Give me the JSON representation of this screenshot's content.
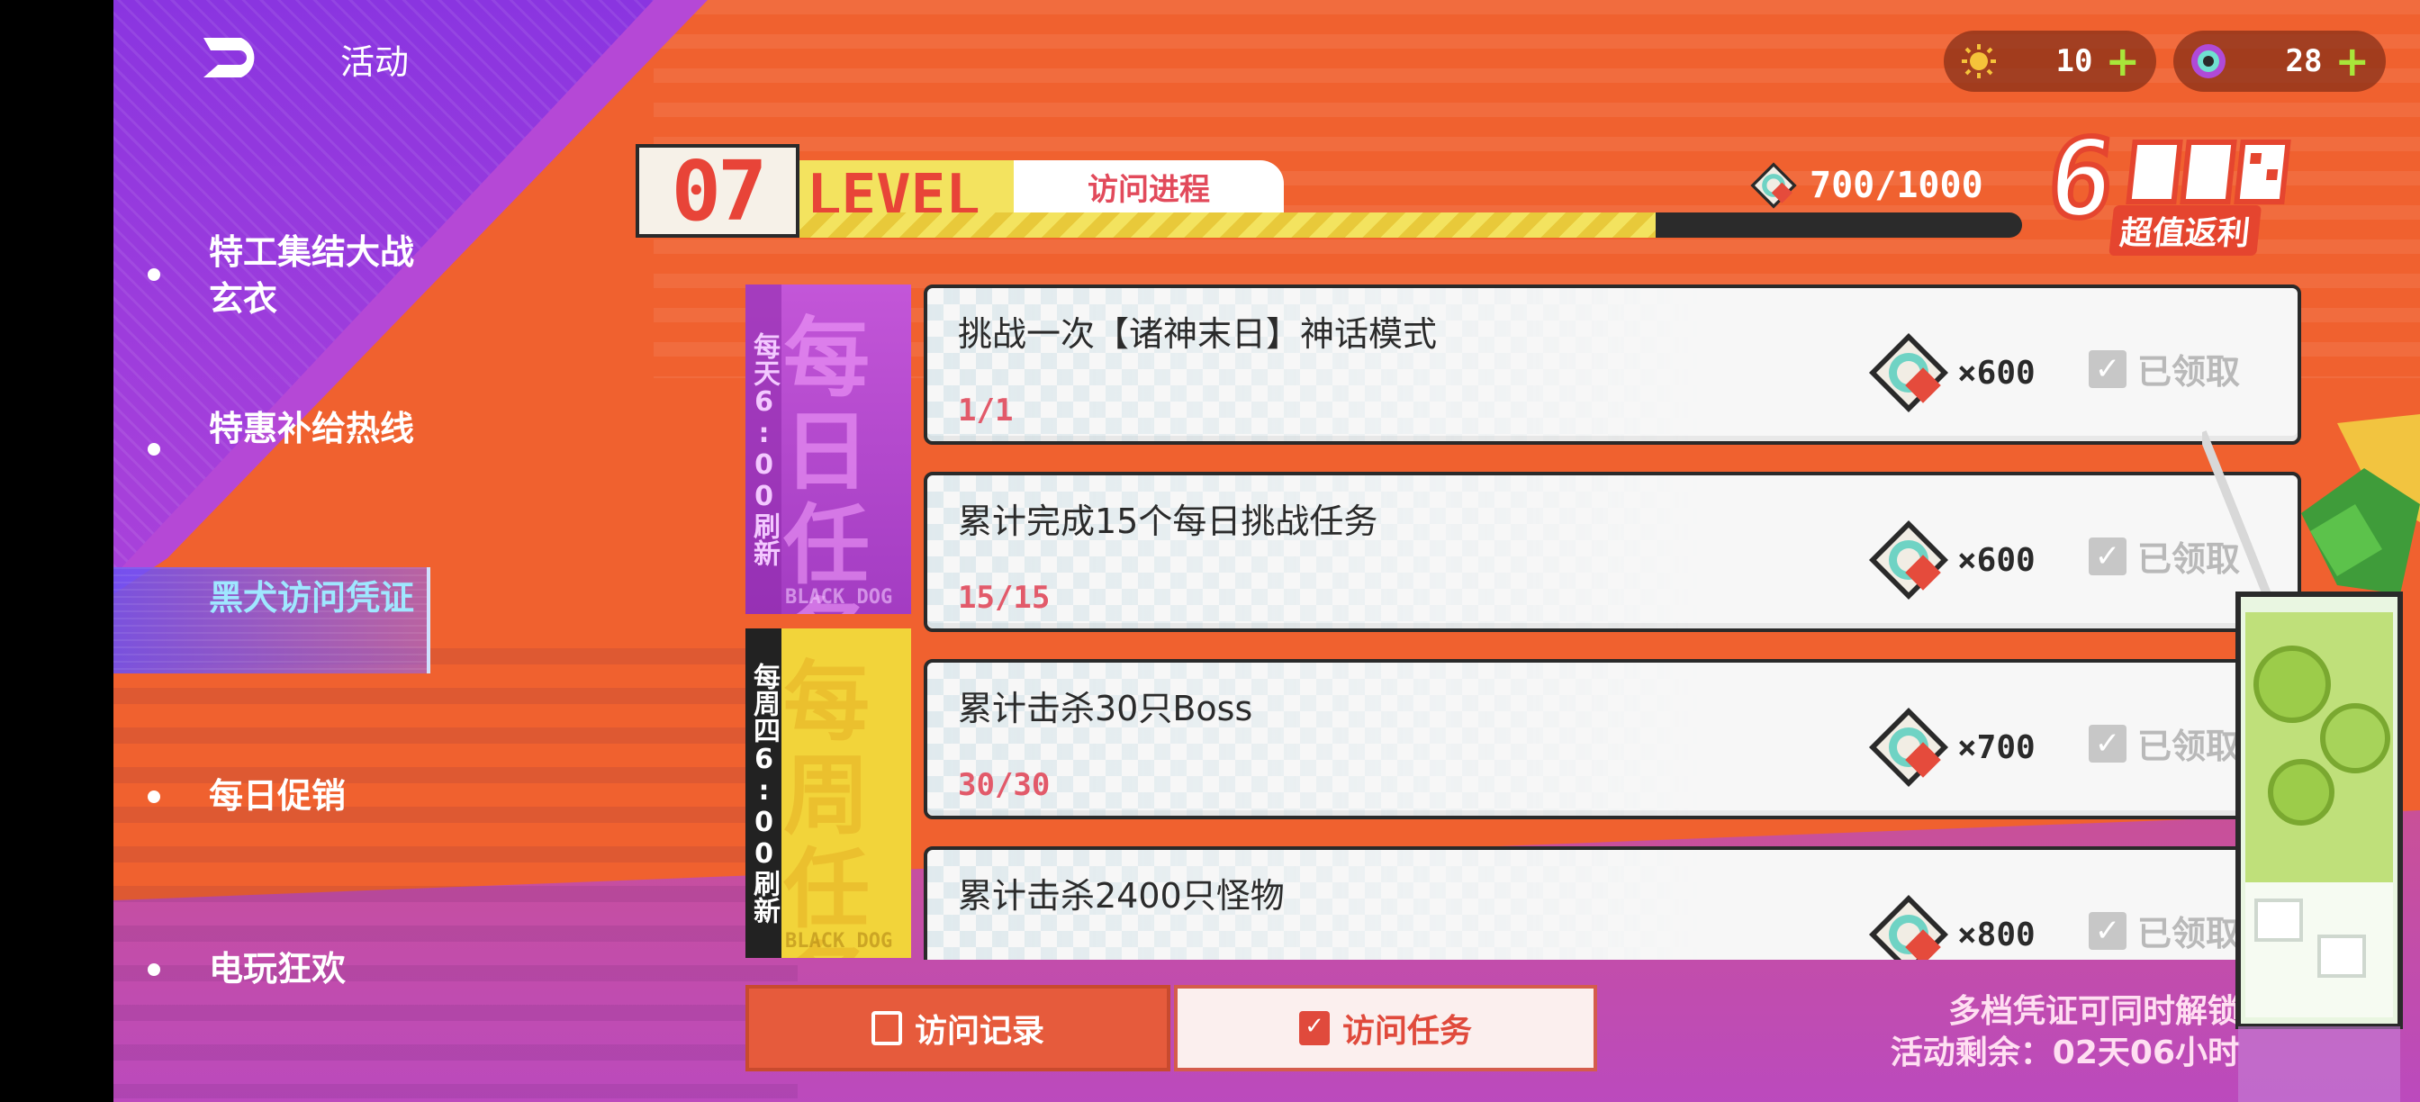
{
  "header": {
    "title": "活动",
    "currencies": [
      {
        "icon": "sun-token-icon",
        "value": "10"
      },
      {
        "icon": "eye-token-icon",
        "value": "28"
      }
    ]
  },
  "sidebar": {
    "items": [
      {
        "label": "特工集结大战玄衣",
        "active": false
      },
      {
        "label": "特惠补给热线",
        "active": false
      },
      {
        "label": "黑犬访问凭证",
        "active": true
      },
      {
        "label": "每日促销",
        "active": false
      },
      {
        "label": "电玩狂欢",
        "active": false
      }
    ]
  },
  "level": {
    "number": "07",
    "word": "LEVEL",
    "progress_label": "访问进程",
    "current": 700,
    "max": 1000,
    "count_text": "700/1000",
    "bonus_big": "6",
    "bonus_sub": "超值返利"
  },
  "categories": {
    "daily": {
      "vertical": "每天6:00刷新",
      "big": "每日任务",
      "brand": "BLACK DOG"
    },
    "weekly": {
      "vertical": "每周四6:00刷新",
      "big": "每周任务",
      "brand": "BLACK DOG"
    }
  },
  "tasks": [
    {
      "title": "挑战一次【诸神末日】神话模式",
      "progress": "1/1",
      "reward": "×600",
      "status": "已领取"
    },
    {
      "title": "累计完成15个每日挑战任务",
      "progress": "15/15",
      "reward": "×600",
      "status": "已领取"
    },
    {
      "title": "累计击杀30只Boss",
      "progress": "30/30",
      "reward": "×700",
      "status": "已领取"
    },
    {
      "title": "累计击杀2400只怪物",
      "progress": "",
      "reward": "×800",
      "status": "已领取"
    }
  ],
  "bottom_tabs": {
    "record": "访问记录",
    "task": "访问任务"
  },
  "footer": {
    "note1": "多档凭证可同时解锁",
    "note2": "活动剩余：02天06小时"
  },
  "colors": {
    "accent_orange": "#f0612f",
    "accent_purple": "#a640da",
    "highlight_yellow": "#f3e35f",
    "level_red": "#e84438"
  }
}
